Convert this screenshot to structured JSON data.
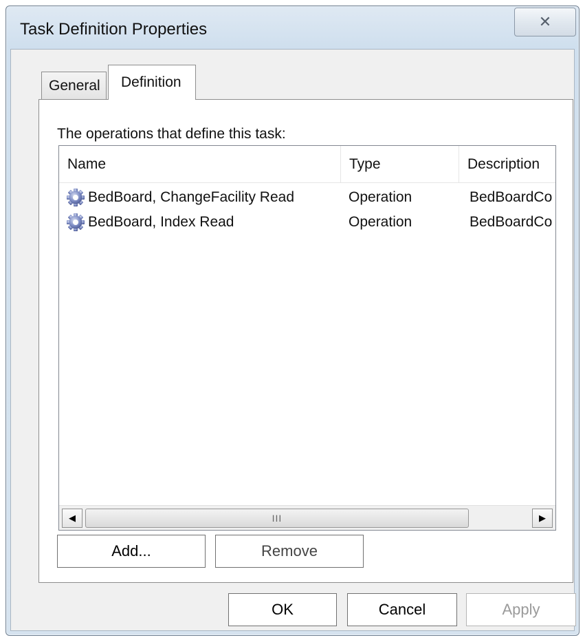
{
  "window": {
    "title": "Task Definition Properties",
    "close_glyph": "✕"
  },
  "tabs": [
    {
      "label": "General",
      "selected": false
    },
    {
      "label": "Definition",
      "selected": true
    }
  ],
  "panel": {
    "label": "The operations that define this task:",
    "columns": [
      "Name",
      "Type",
      "Description"
    ],
    "rows": [
      {
        "name": "BedBoard, ChangeFacility Read",
        "type": "Operation",
        "description": "BedBoardCo",
        "icon": "gear-icon"
      },
      {
        "name": "BedBoard, Index Read",
        "type": "Operation",
        "description": "BedBoardCo",
        "icon": "gear-icon"
      }
    ],
    "scrollbar": {
      "thumb_grip": "III"
    },
    "add_label": "Add...",
    "remove_label": "Remove"
  },
  "footer": {
    "ok_label": "OK",
    "cancel_label": "Cancel",
    "apply_label": "Apply"
  },
  "colors": {
    "frame": "#dfe9f3",
    "client": "#f0f0f0",
    "gear": "#6f7fb5"
  }
}
